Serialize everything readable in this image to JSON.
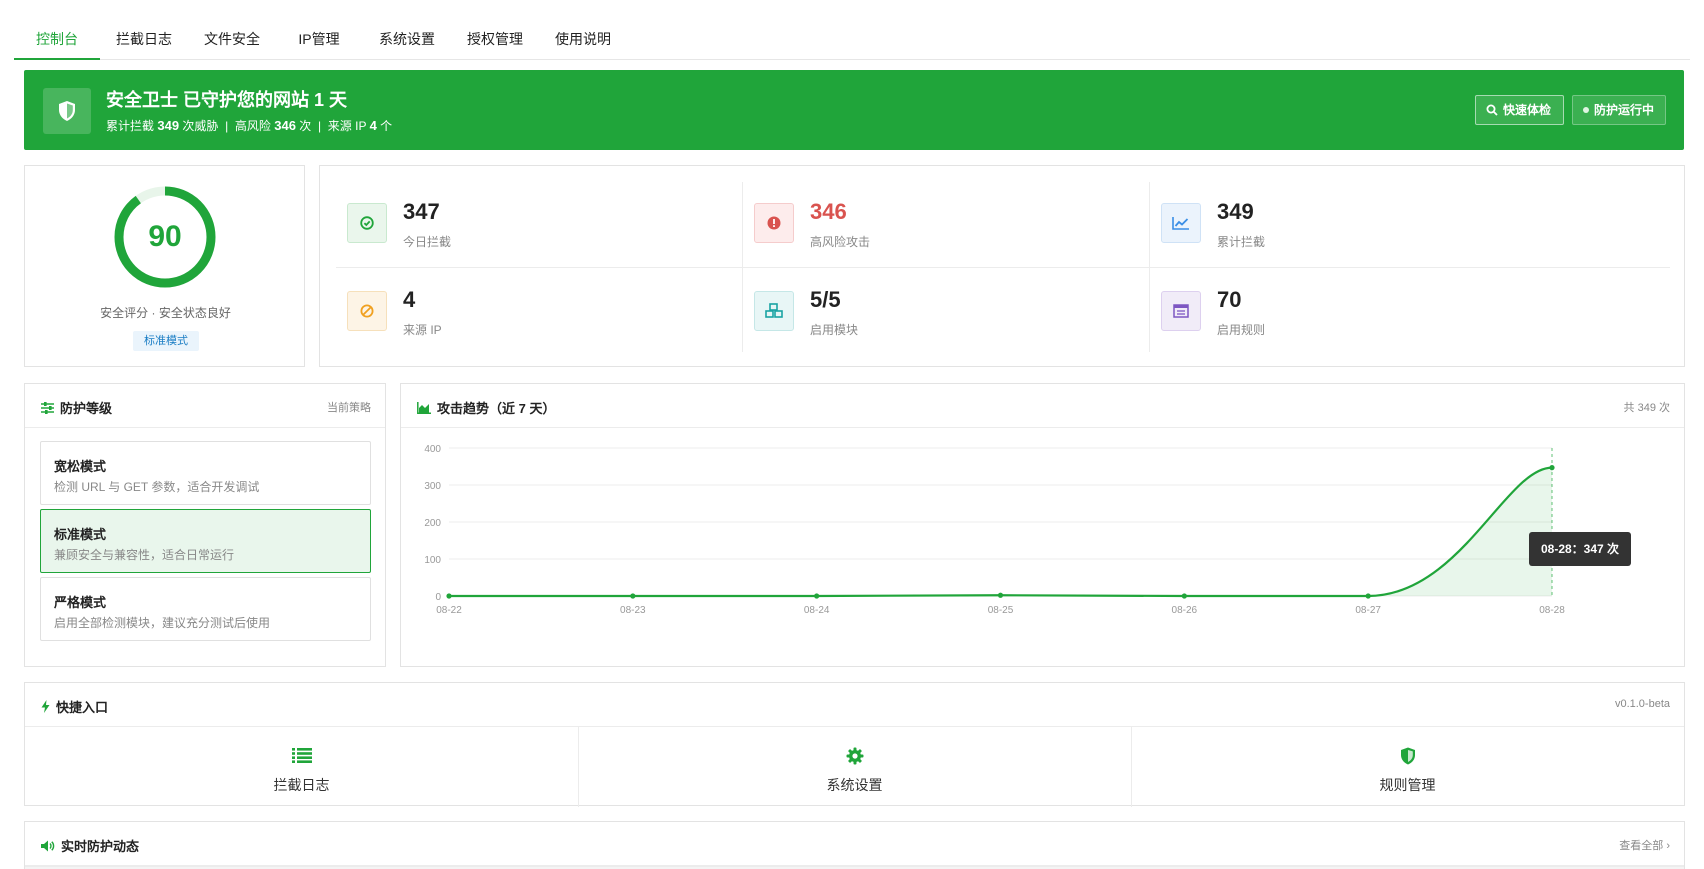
{
  "tabs": [
    {
      "label": "控制台",
      "active": true
    },
    {
      "label": "拦截日志"
    },
    {
      "label": "文件安全"
    },
    {
      "label": "IP管理"
    },
    {
      "label": "系统设置"
    },
    {
      "label": "授权管理"
    },
    {
      "label": "使用说明"
    }
  ],
  "banner": {
    "title": "安全卫士 已守护您的网站 1 天",
    "sub_prefix": "累计拦截",
    "total_blocked": "349",
    "sub_mid1": "次威胁",
    "sep": "|",
    "high_prefix": "高风险",
    "high_risk": "346",
    "unit_times": "次",
    "ip_prefix": "来源 IP",
    "ip_count": "4",
    "unit_ip": "个",
    "scan_button": "快速体检",
    "status_button": "防护运行中",
    "color": "#20a53a"
  },
  "score": {
    "value": "90",
    "percent": 90,
    "label": "安全评分 · 安全状态良好",
    "mode_tag": "标准模式"
  },
  "stats": [
    {
      "value": "347",
      "label": "今日拦截",
      "icon": "check-circle-icon",
      "color": "#20a53a"
    },
    {
      "value": "346",
      "label": "高风险攻击",
      "icon": "alert-circle-icon",
      "color": "#d9534f"
    },
    {
      "value": "349",
      "label": "累计拦截",
      "icon": "trend-chart-icon",
      "color": "#3a8ee6"
    },
    {
      "value": "4",
      "label": "来源 IP",
      "icon": "ban-icon",
      "color": "#f0a020"
    },
    {
      "value": "5/5",
      "label": "启用模块",
      "icon": "cubes-icon",
      "color": "#1aa3a3"
    },
    {
      "value": "70",
      "label": "启用规则",
      "icon": "list-window-icon",
      "color": "#7e57c2"
    }
  ],
  "protection": {
    "title": "防护等级",
    "right_label": "当前策略",
    "levels": [
      {
        "name": "宽松模式",
        "desc": "检测 URL 与 GET 参数，适合开发调试",
        "active": false
      },
      {
        "name": "标准模式",
        "desc": "兼顾安全与兼容性，适合日常运行",
        "active": true
      },
      {
        "name": "严格模式",
        "desc": "启用全部检测模块，建议充分测试后使用",
        "active": false
      }
    ]
  },
  "trend": {
    "title": "攻击趋势（近 7 天）",
    "right_label": "共 349 次",
    "tooltip": "08-28：347 次"
  },
  "chart_data": {
    "type": "area",
    "x": [
      "08-22",
      "08-23",
      "08-24",
      "08-25",
      "08-26",
      "08-27",
      "08-28"
    ],
    "series": [
      {
        "values": [
          0,
          0,
          0,
          2,
          0,
          0,
          347
        ]
      }
    ],
    "yticks": [
      0,
      100,
      200,
      300,
      400
    ],
    "ylim": [
      0,
      400
    ],
    "grid": true,
    "color": "#20a53a"
  },
  "quick": {
    "title": "快捷入口",
    "version": "v0.1.0-beta",
    "items": [
      {
        "label": "拦截日志",
        "icon": "list-icon"
      },
      {
        "label": "系统设置",
        "icon": "gear-icon"
      },
      {
        "label": "规则管理",
        "icon": "shield-icon"
      }
    ]
  },
  "live": {
    "title": "实时防护动态",
    "view_all": "查看全部 ›"
  }
}
